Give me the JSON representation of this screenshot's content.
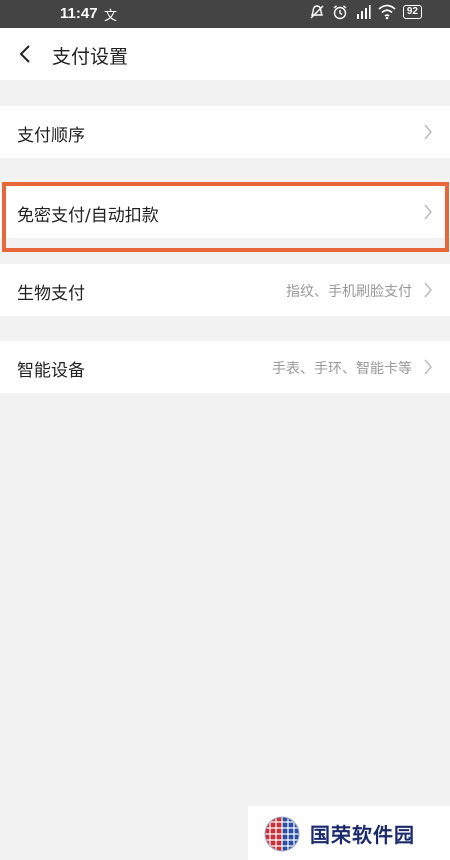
{
  "status_bar": {
    "time": "11:47",
    "notification_glyph": "文",
    "battery": "92",
    "icons": [
      "mute-icon",
      "alarm-icon",
      "signal-icon",
      "wifi-icon",
      "battery-icon"
    ]
  },
  "header": {
    "title": "支付设置",
    "back_icon": "back-arrow-icon"
  },
  "settings": [
    {
      "label": "支付顺序",
      "value": ""
    },
    {
      "label": "免密支付/自动扣款",
      "value": "",
      "highlighted": true
    },
    {
      "label": "生物支付",
      "value": "指纹、手机刷脸支付"
    },
    {
      "label": "智能设备",
      "value": "手表、手环、智能卡等"
    }
  ],
  "watermark": {
    "text": "国荣软件园"
  },
  "colors": {
    "highlight": "#e8683a",
    "background": "#f2f2f2",
    "status_bar": "#444444"
  }
}
